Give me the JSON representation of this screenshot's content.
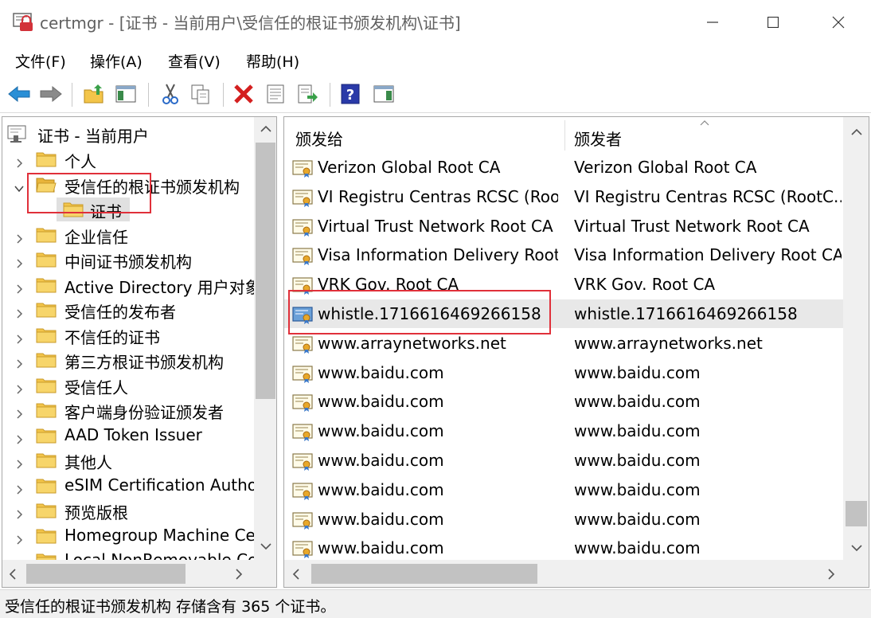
{
  "window": {
    "title": "certmgr - [证书 - 当前用户\\受信任的根证书颁发机构\\证书]"
  },
  "menu": {
    "items": [
      "文件(F)",
      "操作(A)",
      "查看(V)",
      "帮助(H)"
    ]
  },
  "toolbar": {
    "buttons": [
      "back-arrow-icon",
      "forward-arrow-icon",
      "up-folder-icon",
      "show-hide-tree-icon",
      "cut-icon",
      "copy-icon",
      "delete-icon",
      "properties-icon",
      "export-list-icon",
      "help-icon",
      "action-pane-icon"
    ]
  },
  "tree": {
    "root": "证书 - 当前用户",
    "items": [
      {
        "label": "个人",
        "expanded": false
      },
      {
        "label": "受信任的根证书颁发机构",
        "expanded": true
      },
      {
        "label": "证书",
        "child": true,
        "selected": true
      },
      {
        "label": "企业信任",
        "expanded": false
      },
      {
        "label": "中间证书颁发机构",
        "expanded": false
      },
      {
        "label": "Active Directory 用户对象",
        "expanded": false
      },
      {
        "label": "受信任的发布者",
        "expanded": false
      },
      {
        "label": "不信任的证书",
        "expanded": false
      },
      {
        "label": "第三方根证书颁发机构",
        "expanded": false
      },
      {
        "label": "受信任人",
        "expanded": false
      },
      {
        "label": "客户端身份验证颁发者",
        "expanded": false
      },
      {
        "label": "AAD Token Issuer",
        "expanded": false
      },
      {
        "label": "其他人",
        "expanded": false
      },
      {
        "label": "eSIM Certification Authorities",
        "expanded": false
      },
      {
        "label": "预览版根",
        "expanded": false
      },
      {
        "label": "Homegroup Machine Certificates",
        "expanded": false
      },
      {
        "label": "Local NonRemovable Certificates",
        "expanded": false
      }
    ]
  },
  "list": {
    "columns": [
      "颁发给",
      "颁发者"
    ],
    "rows": [
      {
        "issued_to": "Verizon Global Root CA",
        "issued_by": "Verizon Global Root CA"
      },
      {
        "issued_to": "VI Registru Centras RCSC (Roo...",
        "issued_by": "VI Registru Centras RCSC (RootC..."
      },
      {
        "issued_to": "Virtual Trust Network Root CA",
        "issued_by": "Virtual Trust Network Root CA"
      },
      {
        "issued_to": "Visa Information Delivery Root...",
        "issued_by": "Visa Information Delivery Root CA"
      },
      {
        "issued_to": "VRK Gov. Root CA",
        "issued_by": "VRK Gov. Root CA"
      },
      {
        "issued_to": "whistle.1716616469266158",
        "issued_by": "whistle.1716616469266158",
        "selected": true
      },
      {
        "issued_to": "www.arraynetworks.net",
        "issued_by": "www.arraynetworks.net"
      },
      {
        "issued_to": "www.baidu.com",
        "issued_by": "www.baidu.com"
      },
      {
        "issued_to": "www.baidu.com",
        "issued_by": "www.baidu.com"
      },
      {
        "issued_to": "www.baidu.com",
        "issued_by": "www.baidu.com"
      },
      {
        "issued_to": "www.baidu.com",
        "issued_by": "www.baidu.com"
      },
      {
        "issued_to": "www.baidu.com",
        "issued_by": "www.baidu.com"
      },
      {
        "issued_to": "www.baidu.com",
        "issued_by": "www.baidu.com"
      },
      {
        "issued_to": "www.baidu.com",
        "issued_by": "www.baidu.com"
      }
    ]
  },
  "status": {
    "text": "受信任的根证书颁发机构 存储含有 365 个证书。"
  },
  "colors": {
    "annotation": "#e0303a",
    "selection": "#e8e8e8",
    "folder": "#f3c54a"
  }
}
